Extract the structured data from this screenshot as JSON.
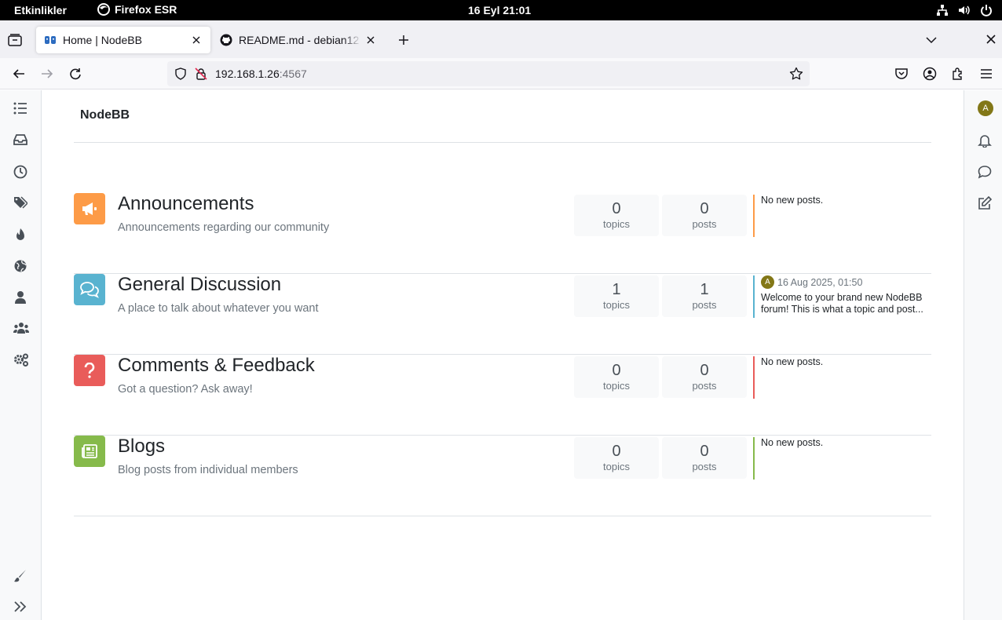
{
  "topbar": {
    "activities": "Etkinlikler",
    "app_name": "Firefox ESR",
    "clock": "16 Eyl  21:01"
  },
  "tabs": [
    {
      "title": "Home | NodeBB",
      "active": true
    },
    {
      "title": "README.md - debian12 [",
      "active": false
    }
  ],
  "navbar": {
    "url_host": "192.168.1.26",
    "url_port": ":4567"
  },
  "forum": {
    "brand": "NodeBB",
    "user_initial": "A"
  },
  "categories": [
    {
      "name": "Announcements",
      "description": "Announcements regarding our community",
      "topics": "0",
      "topics_label": "topics",
      "posts": "0",
      "posts_label": "posts",
      "teaser": "No new posts.",
      "color": "#fd9b47",
      "icon": "bullhorn-icon"
    },
    {
      "name": "General Discussion",
      "description": "A place to talk about whatever you want",
      "topics": "1",
      "topics_label": "topics",
      "posts": "1",
      "posts_label": "posts",
      "teaser_date": "16 Aug 2025, 01:50",
      "teaser_avatar": "A",
      "teaser": "Welcome to your brand new NodeBB forum! This is what a topic and post...",
      "color": "#59b3d0",
      "icon": "comments-icon"
    },
    {
      "name": "Comments & Feedback",
      "description": "Got a question? Ask away!",
      "topics": "0",
      "topics_label": "topics",
      "posts": "0",
      "posts_label": "posts",
      "teaser": "No new posts.",
      "color": "#e95c5a",
      "icon": "question-icon"
    },
    {
      "name": "Blogs",
      "description": "Blog posts from individual members",
      "topics": "0",
      "topics_label": "topics",
      "posts": "0",
      "posts_label": "posts",
      "teaser": "No new posts.",
      "color": "#86ba4b",
      "icon": "newspaper-icon"
    }
  ]
}
